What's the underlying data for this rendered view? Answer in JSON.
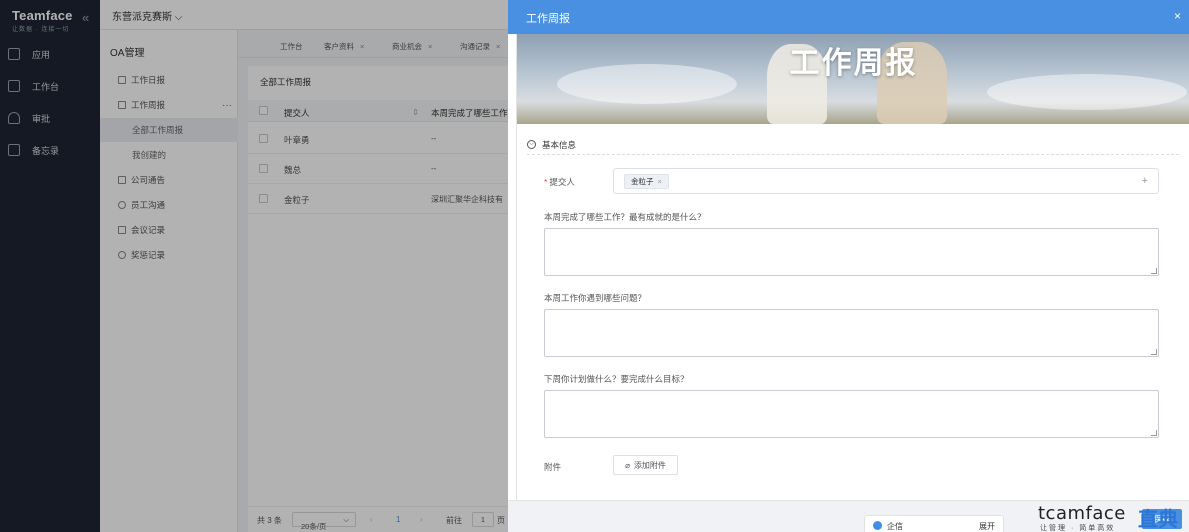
{
  "app": {
    "brand": "Teamface",
    "slogan": "让数据 · 连接一切",
    "company": "东营派克赛斯"
  },
  "sidebar": {
    "items": [
      {
        "label": "应用",
        "icon": "grid-icon"
      },
      {
        "label": "工作台",
        "icon": "monitor-icon"
      },
      {
        "label": "审批",
        "icon": "user-icon"
      },
      {
        "label": "备忘录",
        "icon": "memo-icon"
      }
    ]
  },
  "submenu": {
    "title": "OA管理",
    "items": [
      {
        "label": "工作日报",
        "level": 1
      },
      {
        "label": "工作周报",
        "level": 1,
        "more": "···"
      },
      {
        "label": "全部工作周报",
        "level": 2,
        "active": true
      },
      {
        "label": "我创建的",
        "level": 2
      },
      {
        "label": "公司通告",
        "level": 1
      },
      {
        "label": "员工沟通",
        "level": 1
      },
      {
        "label": "会议记录",
        "level": 1
      },
      {
        "label": "奖惩记录",
        "level": 1
      }
    ]
  },
  "tabs": [
    {
      "label": "工作台",
      "closable": false
    },
    {
      "label": "客户资料",
      "closable": true
    },
    {
      "label": "商业机会",
      "closable": true
    },
    {
      "label": "沟通记录",
      "closable": true
    }
  ],
  "list": {
    "title": "全部工作周报",
    "columns": [
      "提交人",
      "本周完成了哪些工作"
    ],
    "rows": [
      {
        "submitter": "叶章勇",
        "done": "--"
      },
      {
        "submitter": "魏总",
        "done": "--"
      },
      {
        "submitter": "金粒子",
        "done": "深圳汇聚华企科技有"
      }
    ]
  },
  "pager": {
    "total": "共 3 条",
    "size": "20条/页",
    "prev": "‹",
    "current": "1",
    "next": "›",
    "goto_label": "前往",
    "goto_value": "1",
    "page_unit": "页"
  },
  "drawer": {
    "title": "工作周报",
    "close": "×",
    "banner_title": "工作周报",
    "section": "基本信息",
    "submitter_label": "提交人",
    "submitter_tag": "金粒子",
    "q1": "本周完成了哪些工作？最有成就的是什么？",
    "q2": "本周工作你遇到哪些问题？",
    "q3": "下周你计划做什么？要完成什么目标？",
    "attach_label": "附件",
    "attach_button": "添加附件",
    "save": "保存"
  },
  "chat": {
    "name": "企信",
    "expand": "展开"
  },
  "watermark": {
    "text": "tcamface",
    "sub": "让管理 · 简单高效",
    "blue": "直典"
  }
}
